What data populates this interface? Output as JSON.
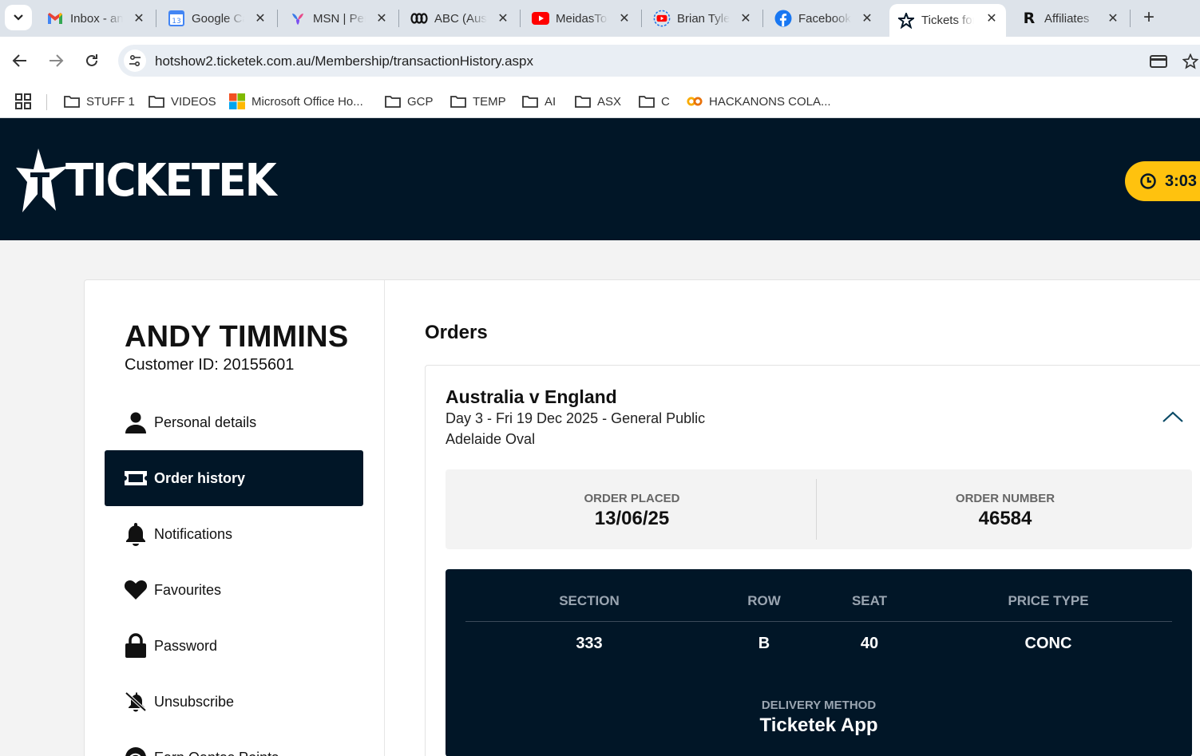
{
  "browser": {
    "tabs": [
      {
        "title": "Inbox - andy",
        "icon": "gmail-icon"
      },
      {
        "title": "Google Calendar",
        "icon": "google-calendar-icon"
      },
      {
        "title": "MSN | Personalized",
        "icon": "msn-icon"
      },
      {
        "title": "ABC (Australian",
        "icon": "abc-icon"
      },
      {
        "title": "MeidasTouch",
        "icon": "youtube-icon"
      },
      {
        "title": "Brian Tyler",
        "icon": "youtube-live-icon"
      },
      {
        "title": "Facebook",
        "icon": "facebook-icon"
      },
      {
        "title": "Tickets for",
        "icon": "ticketek-icon",
        "active": true
      },
      {
        "title": "Affiliates",
        "icon": "r-icon"
      }
    ],
    "url": "hotshow2.ticketek.com.au/Membership/transactionHistory.aspx",
    "bookmarks": [
      {
        "label": "STUFF 1",
        "icon": "folder-icon"
      },
      {
        "label": "VIDEOS",
        "icon": "folder-icon"
      },
      {
        "label": "Microsoft Office Ho...",
        "icon": "microsoft-icon"
      },
      {
        "label": "GCP",
        "icon": "folder-icon"
      },
      {
        "label": "TEMP",
        "icon": "folder-icon"
      },
      {
        "label": "AI",
        "icon": "folder-icon"
      },
      {
        "label": "ASX",
        "icon": "folder-icon"
      },
      {
        "label": "C",
        "icon": "folder-icon"
      },
      {
        "label": "HACKANONS COLA...",
        "icon": "colab-icon"
      }
    ]
  },
  "header": {
    "logo_text": "TICKETEK",
    "timer": "3:03",
    "colors": {
      "navy": "#011627",
      "accent": "#ffc20e"
    }
  },
  "customer": {
    "name": "ANDY TIMMINS",
    "id_text": "Customer ID: 20155601"
  },
  "menu": [
    {
      "label": "Personal details",
      "icon": "person-icon"
    },
    {
      "label": "Order history",
      "icon": "ticket-icon",
      "active": true
    },
    {
      "label": "Notifications",
      "icon": "bell-icon"
    },
    {
      "label": "Favourites",
      "icon": "heart-icon"
    },
    {
      "label": "Password",
      "icon": "lock-icon"
    },
    {
      "label": "Unsubscribe",
      "icon": "bell-off-icon"
    },
    {
      "label": "Earn Qantas Points",
      "icon": "qantas-icon"
    }
  ],
  "orders": {
    "heading": "Orders",
    "order": {
      "event_title": "Australia v England",
      "event_subtitle": "Day 3 - Fri 19 Dec 2025 - General Public",
      "venue": "Adelaide Oval",
      "order_placed_label": "ORDER PLACED",
      "order_placed": "13/06/25",
      "order_number_label": "ORDER NUMBER",
      "order_number": "46584",
      "seat_headers": [
        "SECTION",
        "ROW",
        "SEAT",
        "PRICE TYPE"
      ],
      "seat_values": [
        "333",
        "B",
        "40",
        "CONC"
      ],
      "delivery_label": "DELIVERY METHOD",
      "delivery_value": "Ticketek App"
    }
  }
}
